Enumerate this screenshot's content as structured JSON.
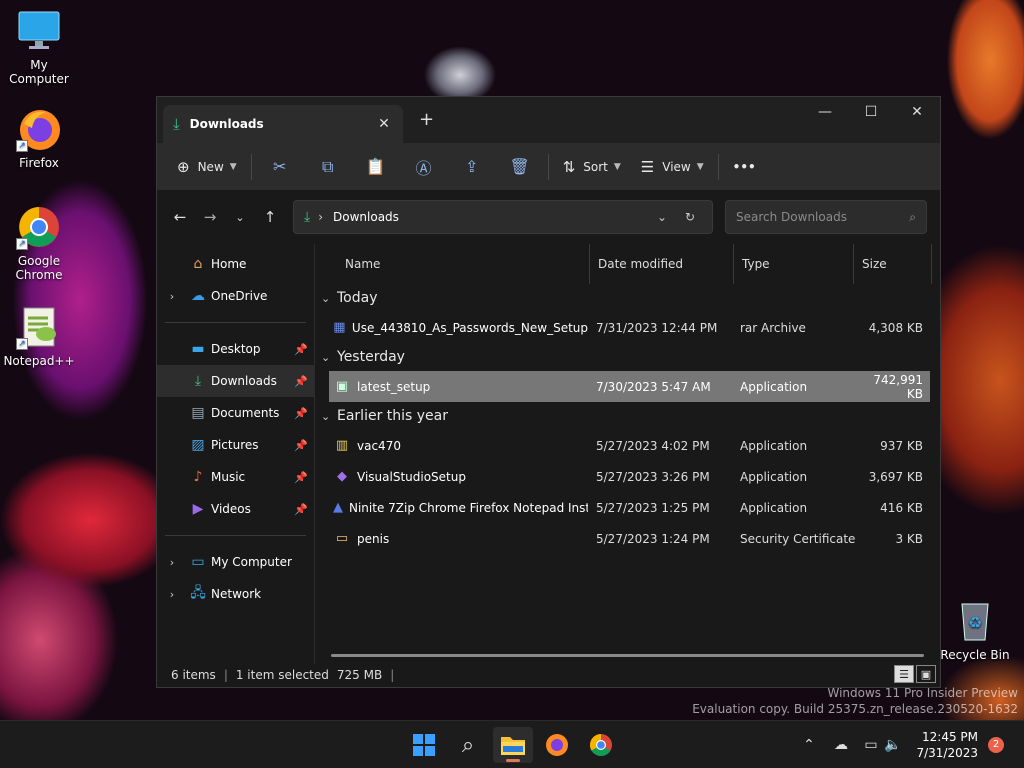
{
  "desktop": {
    "icons": [
      {
        "label": "My Computer",
        "icon": "monitor-icon"
      },
      {
        "label": "Firefox",
        "icon": "firefox-icon"
      },
      {
        "label": "Google Chrome",
        "icon": "chrome-icon"
      },
      {
        "label": "Notepad++",
        "icon": "notepadpp-icon"
      },
      {
        "label": "Recycle Bin",
        "icon": "recycle-bin-icon"
      }
    ],
    "watermark": {
      "line1": "Windows 11 Pro Insider Preview",
      "line2": "Evaluation copy. Build 25375.zn_release.230520-1632"
    }
  },
  "window": {
    "tab_title": "Downloads",
    "toolbar": {
      "new_label": "New",
      "sort_label": "Sort",
      "view_label": "View",
      "more_label": "•••"
    },
    "address": {
      "path": "Downloads",
      "search_placeholder": "Search Downloads"
    },
    "nav": {
      "home": "Home",
      "onedrive": "OneDrive",
      "pinned": [
        "Desktop",
        "Downloads",
        "Documents",
        "Pictures",
        "Music",
        "Videos"
      ],
      "my_computer": "My Computer",
      "network": "Network"
    },
    "columns": {
      "name": "Name",
      "date": "Date modified",
      "type": "Type",
      "size": "Size"
    },
    "groups": [
      {
        "label": "Today",
        "files": [
          {
            "name": "Use_443810_As_Passwords_New_Setup",
            "date": "7/31/2023 12:44 PM",
            "type": "rar Archive",
            "size": "4,308 KB",
            "icon": "rar-archive-icon"
          }
        ]
      },
      {
        "label": "Yesterday",
        "files": [
          {
            "name": "latest_setup",
            "date": "7/30/2023 5:47 AM",
            "type": "Application",
            "size": "742,991 KB",
            "icon": "installer-icon"
          }
        ]
      },
      {
        "label": "Earlier this year",
        "files": [
          {
            "name": "vac470",
            "date": "5/27/2023 4:02 PM",
            "type": "Application",
            "size": "937 KB",
            "icon": "application-icon"
          },
          {
            "name": "VisualStudioSetup",
            "date": "5/27/2023 3:26 PM",
            "type": "Application",
            "size": "3,697 KB",
            "icon": "visual-studio-icon"
          },
          {
            "name": "Ninite 7Zip Chrome Firefox Notepad Inst...",
            "date": "5/27/2023 1:25 PM",
            "type": "Application",
            "size": "416 KB",
            "icon": "ninite-icon"
          },
          {
            "name": "penis",
            "date": "5/27/2023 1:24 PM",
            "type": "Security Certificate",
            "size": "3 KB",
            "icon": "certificate-icon"
          }
        ]
      }
    ],
    "status": {
      "items": "6 items",
      "selected": "1 item selected",
      "selected_size": "725 MB"
    }
  },
  "taskbar": {
    "time": "12:45 PM",
    "date": "7/31/2023",
    "notification_count": "2"
  }
}
